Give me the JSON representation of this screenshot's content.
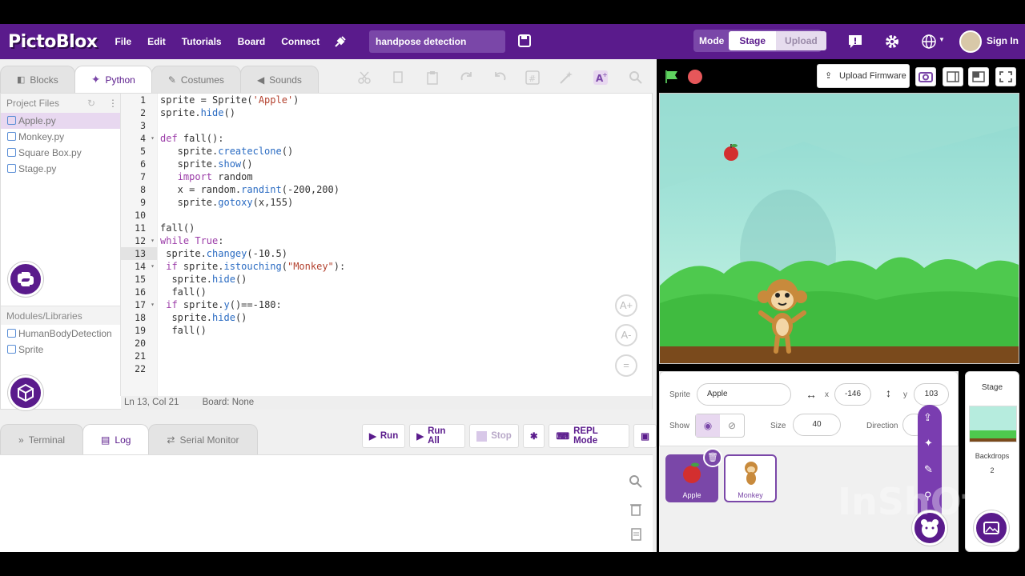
{
  "app": {
    "logo": "PictoBlox"
  },
  "menu": {
    "items": [
      "File",
      "Edit",
      "Tutorials",
      "Board",
      "Connect"
    ],
    "project_name": "handpose detection"
  },
  "mode": {
    "label": "Mode",
    "stage": "Stage",
    "upload": "Upload"
  },
  "account": {
    "sign_in": "Sign In"
  },
  "editor_tabs": {
    "blocks": "Blocks",
    "python": "Python",
    "costumes": "Costumes",
    "sounds": "Sounds"
  },
  "project_files": {
    "title": "Project Files",
    "files": [
      "Apple.py",
      "Monkey.py",
      "Square Box.py",
      "Stage.py"
    ]
  },
  "modules": {
    "title": "Modules/Libraries",
    "items": [
      "HumanBodyDetection",
      "Sprite"
    ]
  },
  "code": {
    "line_numbers": [
      "1",
      "2",
      "3",
      "4",
      "5",
      "6",
      "7",
      "8",
      "9",
      "10",
      "11",
      "12",
      "13",
      "14",
      "15",
      "16",
      "17",
      "18",
      "19",
      "20",
      "21",
      "22"
    ],
    "lines": [
      "sprite = Sprite('Apple')",
      "sprite.hide()",
      "",
      "def fall():",
      "   sprite.createclone()",
      "   sprite.show()",
      "   import random",
      "   x = random.randint(-200,200)",
      "   sprite.gotoxy(x,155)",
      "",
      "fall()",
      "while True:",
      " sprite.changey(-10.5)",
      " if sprite.istouching(\"Monkey\"):",
      "  sprite.hide()",
      "  fall()",
      " if sprite.y()==-180:",
      "  sprite.hide()",
      "  fall()",
      "",
      "",
      ""
    ]
  },
  "status": {
    "position": "Ln 13, Col 21",
    "board": "Board: None"
  },
  "bottom_tabs": {
    "terminal": "Terminal",
    "log": "Log",
    "serial": "Serial Monitor"
  },
  "run_buttons": {
    "run": "Run",
    "run_all": "Run All",
    "stop": "Stop",
    "repl": "REPL Mode"
  },
  "stage_bar": {
    "upload_firmware": "Upload Firmware"
  },
  "sprite_info": {
    "sprite_label": "Sprite",
    "sprite_name": "Apple",
    "x_label": "x",
    "x": "-146",
    "y_label": "y",
    "y": "103",
    "show_label": "Show",
    "size_label": "Size",
    "size": "40",
    "direction_label": "Direction"
  },
  "sprites": [
    "Apple",
    "Monkey"
  ],
  "stage_panel": {
    "title": "Stage",
    "backdrops_label": "Backdrops",
    "backdrops_count": "2"
  },
  "watermark": "InShOt",
  "colors": {
    "brand": "#5a1b8c",
    "accent": "#7a47a8"
  }
}
